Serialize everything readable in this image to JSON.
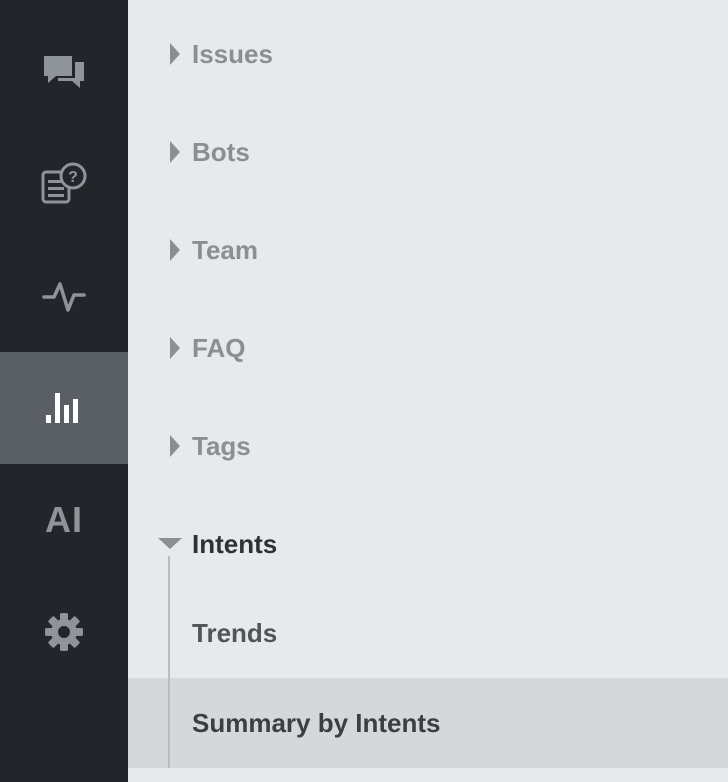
{
  "rail": {
    "items": [
      {
        "icon": "chat-bubbles-icon"
      },
      {
        "icon": "faq-document-icon"
      },
      {
        "icon": "activity-pulse-icon"
      },
      {
        "icon": "bar-chart-icon",
        "active": true
      },
      {
        "icon": "ai-icon",
        "text": "AI"
      },
      {
        "icon": "gear-icon"
      }
    ]
  },
  "menu": {
    "items": [
      {
        "label": "Issues",
        "expanded": false
      },
      {
        "label": "Bots",
        "expanded": false
      },
      {
        "label": "Team",
        "expanded": false
      },
      {
        "label": "FAQ",
        "expanded": false
      },
      {
        "label": "Tags",
        "expanded": false
      },
      {
        "label": "Intents",
        "expanded": true,
        "children": [
          {
            "label": "Trends",
            "selected": false
          },
          {
            "label": "Summary by Intents",
            "selected": true
          }
        ]
      }
    ]
  },
  "colors": {
    "rail_bg": "#22262a",
    "rail_active_bg": "#5a5f66",
    "icon": "#8f9499",
    "icon_active": "#ffffff",
    "main_bg": "#e8e9eb",
    "selected_bg": "#d6d7d9",
    "label_muted": "#8a8f94",
    "label_dark": "#2e3236"
  }
}
